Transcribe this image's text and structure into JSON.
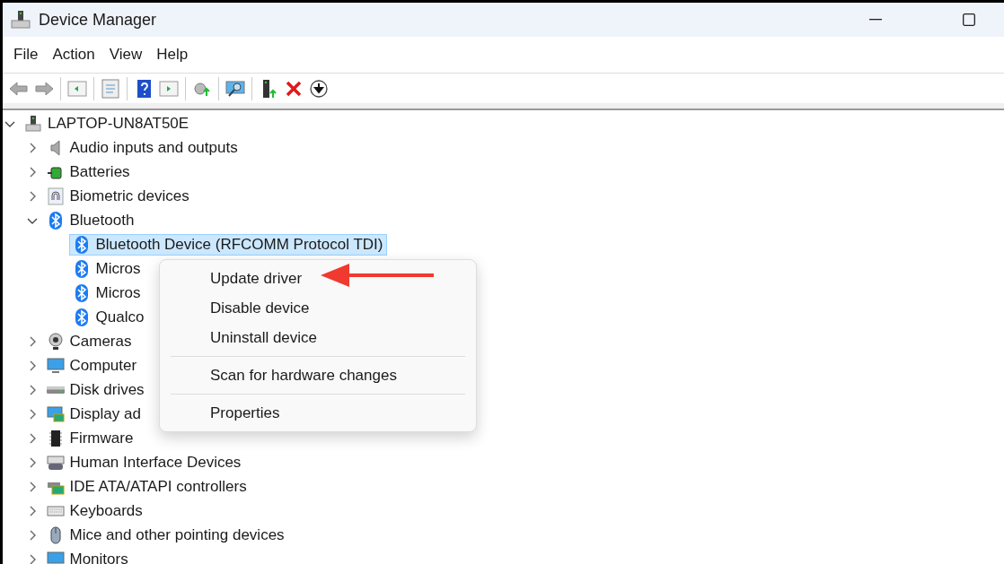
{
  "window": {
    "title": "Device Manager"
  },
  "menu_bar": [
    "File",
    "Action",
    "View",
    "Help"
  ],
  "tree": {
    "label": "LAPTOP-UN8AT50E",
    "kind": "computer",
    "expanded": true,
    "selected": false,
    "children": [
      {
        "label": "Audio inputs and outputs",
        "kind": "speaker",
        "expanded": false,
        "selected": false
      },
      {
        "label": "Batteries",
        "kind": "battery",
        "expanded": false,
        "selected": false
      },
      {
        "label": "Biometric devices",
        "kind": "fingerprint",
        "expanded": false,
        "selected": false
      },
      {
        "label": "Bluetooth",
        "kind": "bluetooth",
        "expanded": true,
        "selected": false,
        "children": [
          {
            "label": "Bluetooth Device (RFCOMM Protocol TDI)",
            "kind": "bluetooth",
            "selected": true
          },
          {
            "label": "Micros",
            "kind": "bluetooth",
            "selected": false
          },
          {
            "label": "Micros",
            "kind": "bluetooth",
            "selected": false
          },
          {
            "label": "Qualco",
            "kind": "bluetooth",
            "selected": false
          }
        ]
      },
      {
        "label": "Cameras",
        "kind": "webcam",
        "expanded": false,
        "selected": false
      },
      {
        "label": "Computer",
        "kind": "monitor",
        "expanded": false,
        "selected": false
      },
      {
        "label": "Disk drives",
        "kind": "disk",
        "expanded": false,
        "selected": false
      },
      {
        "label": "Display ad",
        "kind": "display",
        "expanded": false,
        "selected": false
      },
      {
        "label": "Firmware",
        "kind": "chip",
        "expanded": false,
        "selected": false
      },
      {
        "label": "Human Interface Devices",
        "kind": "hid",
        "expanded": false,
        "selected": false
      },
      {
        "label": "IDE ATA/ATAPI controllers",
        "kind": "card",
        "expanded": false,
        "selected": false
      },
      {
        "label": "Keyboards",
        "kind": "keyboard",
        "expanded": false,
        "selected": false
      },
      {
        "label": "Mice and other pointing devices",
        "kind": "mouse",
        "expanded": false,
        "selected": false
      },
      {
        "label": "Monitors",
        "kind": "monitor",
        "expanded": false,
        "selected": false
      }
    ]
  },
  "context_menu": {
    "groups": [
      [
        "Update driver",
        "Disable device",
        "Uninstall device"
      ],
      [
        "Scan for hardware changes"
      ],
      [
        "Properties"
      ]
    ]
  }
}
